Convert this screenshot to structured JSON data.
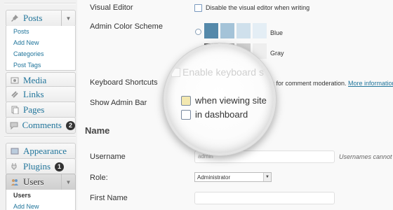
{
  "sidebar": {
    "posts": {
      "label": "Posts",
      "icon": "pushpin-icon"
    },
    "posts_sub": [
      "Posts",
      "Add New",
      "Categories",
      "Post Tags"
    ],
    "media": {
      "label": "Media",
      "icon": "media-icon"
    },
    "links": {
      "label": "Links",
      "icon": "link-icon"
    },
    "pages": {
      "label": "Pages",
      "icon": "page-icon"
    },
    "comments": {
      "label": "Comments",
      "icon": "comments-icon",
      "badge": "2"
    },
    "appearance": {
      "label": "Appearance",
      "icon": "appearance-icon"
    },
    "plugins": {
      "label": "Plugins",
      "icon": "plugin-icon",
      "badge": "1"
    },
    "users": {
      "label": "Users",
      "icon": "users-icon"
    },
    "users_sub": [
      "Users",
      "Add New"
    ]
  },
  "profile": {
    "visual_editor": {
      "label": "Visual Editor",
      "checkbox_label": "Disable the visual editor when writing"
    },
    "color_scheme": {
      "label": "Admin Color Scheme",
      "options": [
        {
          "name": "Blue",
          "colors": [
            "#5589aa",
            "#a4c3d8",
            "#cfe0ec",
            "#e4eef5"
          ]
        },
        {
          "name": "Gray",
          "colors": [
            "#5a5a5a",
            "#a3a3a3",
            "#cfcfcf",
            "#eeeeee"
          ]
        }
      ]
    },
    "keyboard_shortcuts": {
      "label": "Keyboard Shortcuts",
      "desc": "ts for comment moderation.",
      "link": "More information"
    },
    "admin_bar": {
      "label": "Show Admin Bar"
    },
    "name_section": "Name",
    "username": {
      "label": "Username",
      "value": "admin",
      "note": "Usernames cannot"
    },
    "role": {
      "label": "Role:",
      "value": "Administrator"
    },
    "first_name": {
      "label": "First Name"
    }
  },
  "magnifier": {
    "faded_label": "Enable keyboard s",
    "opt1": "when viewing site",
    "opt2": "in dashboard"
  },
  "colors": {
    "link": "#21759b",
    "checkbox_checked_bg": "#f3e8b0"
  }
}
